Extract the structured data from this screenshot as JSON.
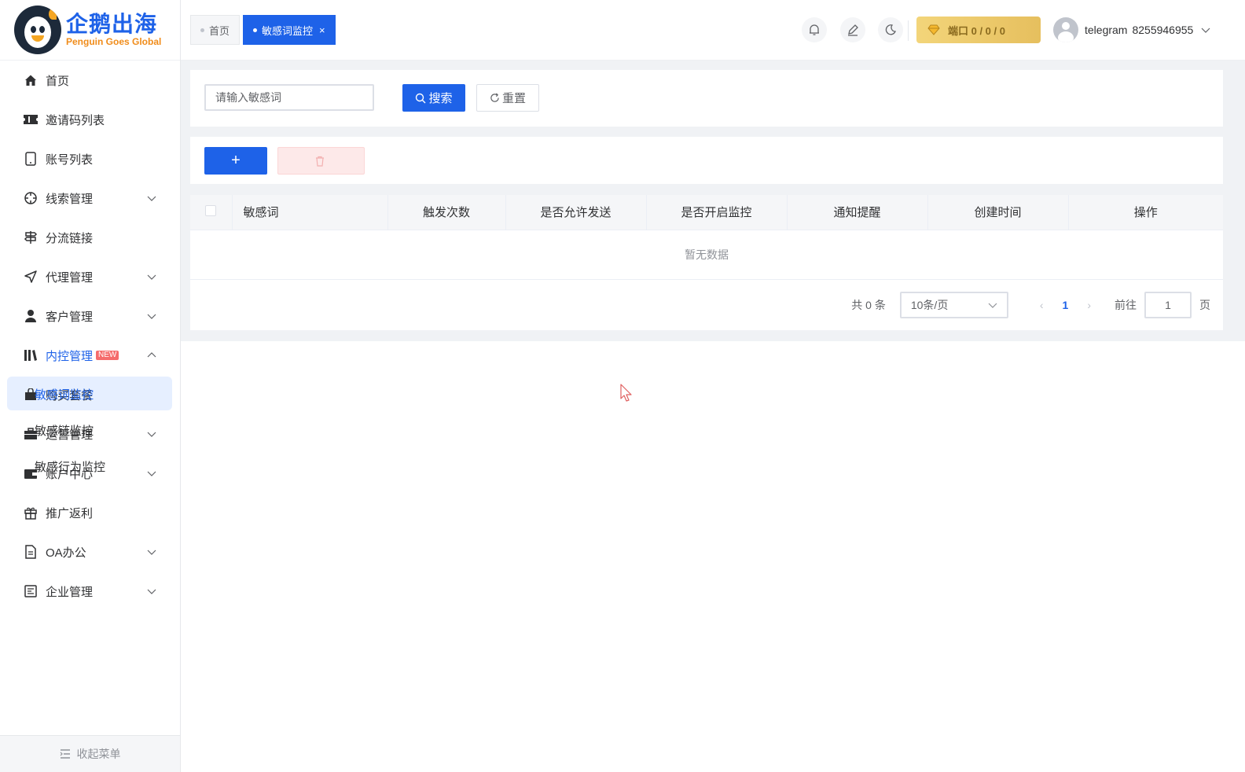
{
  "brand": {
    "name_cn": "企鹅出海",
    "name_en": "Penguin Goes Global",
    "primary_color": "#1e62e8",
    "accent_color": "#f08c1a"
  },
  "sidebar": {
    "items": [
      {
        "label": "首页",
        "icon": "home-icon",
        "expandable": false
      },
      {
        "label": "邀请码列表",
        "icon": "ticket-icon",
        "expandable": false
      },
      {
        "label": "账号列表",
        "icon": "phone-icon",
        "expandable": false
      },
      {
        "label": "线索管理",
        "icon": "target-icon",
        "expandable": true
      },
      {
        "label": "分流链接",
        "icon": "signpost-icon",
        "expandable": false
      },
      {
        "label": "代理管理",
        "icon": "send-icon",
        "expandable": true
      },
      {
        "label": "客户管理",
        "icon": "user-icon",
        "expandable": true
      },
      {
        "label": "内控管理",
        "icon": "library-icon",
        "expandable": true,
        "expanded": true,
        "badge": "NEW"
      },
      {
        "label": "购买套餐",
        "icon": "bag-icon",
        "expandable": false
      },
      {
        "label": "运营管理",
        "icon": "briefcase-icon",
        "expandable": true
      },
      {
        "label": "账户中心",
        "icon": "wallet-icon",
        "expandable": true
      },
      {
        "label": "推广返利",
        "icon": "gift-icon",
        "expandable": false
      },
      {
        "label": "OA办公",
        "icon": "document-icon",
        "expandable": true
      },
      {
        "label": "企业管理",
        "icon": "enterprise-icon",
        "expandable": true
      }
    ],
    "submenu": [
      "敏感词监控",
      "敏感链监控",
      "敏感行为监控"
    ],
    "collapse_label": "收起菜单"
  },
  "header": {
    "tabs": [
      {
        "label": "首页",
        "active": false
      },
      {
        "label": "敏感词监控",
        "active": true,
        "close": "×"
      }
    ],
    "port_label": "端口 0 / 0 / 0",
    "user": {
      "name": "telegram",
      "id": "8255946955"
    }
  },
  "search": {
    "placeholder": "请输入敏感词",
    "search_label": "搜索",
    "reset_label": "重置"
  },
  "actions": {
    "add_label": "+"
  },
  "table": {
    "columns": [
      "敏感词",
      "触发次数",
      "是否允许发送",
      "是否开启监控",
      "通知提醒",
      "创建时间",
      "操作"
    ],
    "empty_text": "暂无数据"
  },
  "pagination": {
    "total_label": "共 0 条",
    "page_size": "10条/页",
    "current_page": "1",
    "goto_label": "前往",
    "goto_value": "1",
    "page_suffix": "页"
  }
}
